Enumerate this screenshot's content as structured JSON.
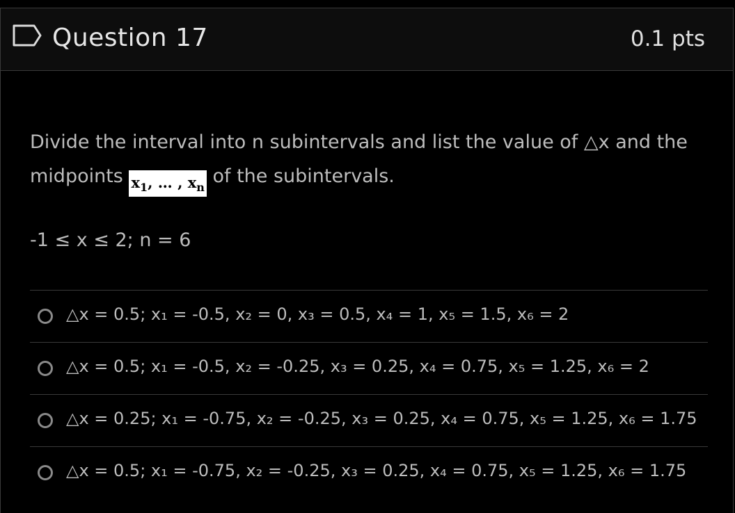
{
  "header": {
    "title": "Question 17",
    "points": "0.1 pts",
    "flag_icon": "flag-outline-icon"
  },
  "question": {
    "text_part1": "Divide the interval into n subintervals and list the value of △x and the midpoints",
    "math_image": {
      "x1": "x",
      "sub1": "1",
      "sep": ", … , ",
      "xn": "x",
      "subn": "n"
    },
    "text_part2": "of the subintervals.",
    "condition": "-1 ≤ x ≤ 2; n = 6"
  },
  "answers": [
    "△x = 0.5; x₁ = -0.5, x₂ = 0, x₃ = 0.5, x₄ = 1, x₅ = 1.5, x₆ = 2",
    "△x = 0.5; x₁ = -0.5, x₂ = -0.25, x₃ = 0.25, x₄ = 0.75, x₅ = 1.25, x₆ = 2",
    "△x = 0.25; x₁ = -0.75, x₂ = -0.25, x₃ = 0.25, x₄ = 0.75, x₅ = 1.25, x₆ = 1.75",
    "△x = 0.5; x₁ = -0.75, x₂ = -0.25, x₃ = 0.25, x₄ = 0.75, x₅ = 1.25, x₆ = 1.75"
  ],
  "colors": {
    "background": "#000000",
    "header_bg": "#0d0d0d",
    "border": "#3a3a3a",
    "text": "#bdbdbd",
    "radio": "#8a8a8a"
  }
}
